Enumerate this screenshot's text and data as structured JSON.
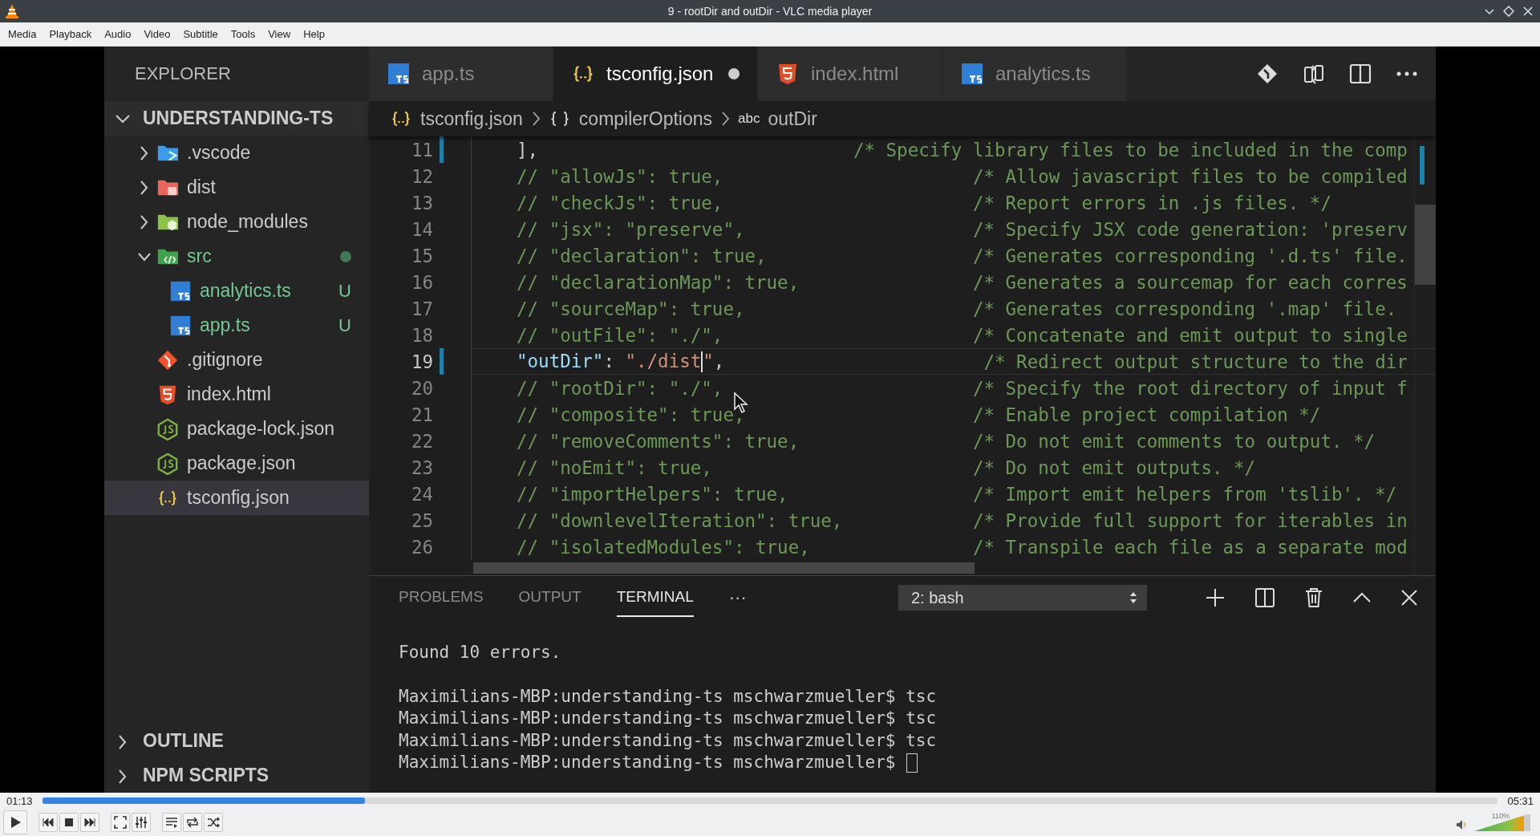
{
  "window": {
    "title": "9 - rootDir and outDir - VLC media player"
  },
  "menu": [
    "Media",
    "Playback",
    "Audio",
    "Video",
    "Subtitle",
    "Tools",
    "View",
    "Help"
  ],
  "editor_app": {
    "explorer": {
      "title": "EXPLORER",
      "workspace": {
        "label": "UNDERSTANDING-TS",
        "expanded": true
      },
      "items": [
        {
          "label": ".vscode",
          "kind": "vscode",
          "expanded": false,
          "selected": false
        },
        {
          "label": "dist",
          "kind": "dist",
          "expanded": false,
          "selected": false
        },
        {
          "label": "node_modules",
          "kind": "modules",
          "expanded": false,
          "selected": false
        },
        {
          "label": "src",
          "kind": "src",
          "expanded": true,
          "selected": false,
          "changed": true,
          "children": [
            {
              "label": "analytics.ts",
              "kind": "ts",
              "selected": false,
              "changed": true,
              "status": "U"
            },
            {
              "label": "app.ts",
              "kind": "ts",
              "selected": false,
              "changed": true,
              "status": "U"
            }
          ]
        },
        {
          "label": ".gitignore",
          "kind": "git",
          "selected": false
        },
        {
          "label": "index.html",
          "kind": "html",
          "selected": false
        },
        {
          "label": "package-lock.json",
          "kind": "npm",
          "selected": false
        },
        {
          "label": "package.json",
          "kind": "npm",
          "selected": false
        },
        {
          "label": "tsconfig.json",
          "kind": "json",
          "selected": true
        }
      ],
      "sections": [
        {
          "label": "OUTLINE",
          "expanded": false
        },
        {
          "label": "NPM SCRIPTS",
          "expanded": false
        }
      ]
    },
    "tabs": [
      {
        "label": "app.ts",
        "kind": "ts",
        "selected": false,
        "dirty": false
      },
      {
        "label": "tsconfig.json",
        "kind": "json",
        "selected": true,
        "dirty": true
      },
      {
        "label": "index.html",
        "kind": "html",
        "selected": false,
        "dirty": false
      },
      {
        "label": "analytics.ts",
        "kind": "ts",
        "selected": false,
        "dirty": false
      }
    ],
    "breadcrumb": [
      {
        "label": "tsconfig.json",
        "kind": "json"
      },
      {
        "label": "compilerOptions",
        "kind": "object"
      },
      {
        "label": "outDir",
        "kind": "string",
        "icon_text": "abc"
      }
    ],
    "lines": [
      {
        "number": "11",
        "kind": "close",
        "code": "],",
        "comment": "/* Specify library files to be included in the comp",
        "modified": true,
        "current": false
      },
      {
        "number": "12",
        "kind": "comment",
        "code": "// \"allowJs\": true,",
        "comment": "/* Allow javascript files to be compiled",
        "modified": false,
        "current": false
      },
      {
        "number": "13",
        "kind": "comment",
        "code": "// \"checkJs\": true,",
        "comment": "/* Report errors in .js files. */",
        "modified": false,
        "current": false
      },
      {
        "number": "14",
        "kind": "comment",
        "code": "// \"jsx\": \"preserve\",",
        "comment": "/* Specify JSX code generation: 'preserv",
        "modified": false,
        "current": false
      },
      {
        "number": "15",
        "kind": "comment",
        "code": "// \"declaration\": true,",
        "comment": "/* Generates corresponding '.d.ts' file.",
        "modified": false,
        "current": false
      },
      {
        "number": "16",
        "kind": "comment",
        "code": "// \"declarationMap\": true,",
        "comment": "/* Generates a sourcemap for each corres",
        "modified": false,
        "current": false
      },
      {
        "number": "17",
        "kind": "comment",
        "code": "// \"sourceMap\": true,",
        "comment": "/* Generates corresponding '.map' file.",
        "modified": false,
        "current": false
      },
      {
        "number": "18",
        "kind": "comment",
        "code": "// \"outFile\": \"./\",",
        "comment": "/* Concatenate and emit output to single",
        "modified": false,
        "current": false
      },
      {
        "number": "19",
        "kind": "setting",
        "key": "\"outDir\"",
        "separator": ": ",
        "value": "\"./dist\"",
        "end": ",",
        "cursor": true,
        "comment": "/* Redirect output structure to the dir",
        "modified": true,
        "current": true
      },
      {
        "number": "20",
        "kind": "comment",
        "code": "// \"rootDir\": \"./\",",
        "comment": "/* Specify the root directory of input f",
        "modified": false,
        "current": false
      },
      {
        "number": "21",
        "kind": "comment",
        "code": "// \"composite\": true,",
        "comment": "/* Enable project compilation */",
        "modified": false,
        "current": false
      },
      {
        "number": "22",
        "kind": "comment",
        "code": "// \"removeComments\": true,",
        "comment": "/* Do not emit comments to output. */",
        "modified": false,
        "current": false
      },
      {
        "number": "23",
        "kind": "comment",
        "code": "// \"noEmit\": true,",
        "comment": "/* Do not emit outputs. */",
        "modified": false,
        "current": false
      },
      {
        "number": "24",
        "kind": "comment",
        "code": "// \"importHelpers\": true,",
        "comment": "/* Import emit helpers from 'tslib'. */",
        "modified": false,
        "current": false
      },
      {
        "number": "25",
        "kind": "comment",
        "code": "// \"downlevelIteration\": true,",
        "comment": "/* Provide full support for iterables in",
        "modified": false,
        "current": false
      },
      {
        "number": "26",
        "kind": "comment",
        "code": "// \"isolatedModules\": true,",
        "comment": "/* Transpile each file as a separate mod",
        "modified": false,
        "current": false
      }
    ],
    "panel": {
      "tabs": [
        {
          "label": "PROBLEMS",
          "selected": false
        },
        {
          "label": "OUTPUT",
          "selected": false
        },
        {
          "label": "TERMINAL",
          "selected": true
        }
      ],
      "more": "···",
      "terminal_select": "2: bash",
      "terminal": [
        {
          "kind": "output",
          "text": "Found 10 errors."
        },
        {
          "kind": "prompt",
          "text": "Maximilians-MBP:understanding-ts mschwarzmueller$ tsc",
          "cursor": false
        },
        {
          "kind": "prompt",
          "text": "Maximilians-MBP:understanding-ts mschwarzmueller$ tsc",
          "cursor": false
        },
        {
          "kind": "prompt",
          "text": "Maximilians-MBP:understanding-ts mschwarzmueller$ tsc",
          "cursor": false
        },
        {
          "kind": "prompt",
          "text": "Maximilians-MBP:understanding-ts mschwarzmueller$",
          "cursor": true
        }
      ]
    }
  },
  "player": {
    "elapsed": "01:13",
    "total": "05:31",
    "progress": {
      "level": 0.222
    },
    "volume": {
      "level": 0.88,
      "label": "110%"
    }
  }
}
